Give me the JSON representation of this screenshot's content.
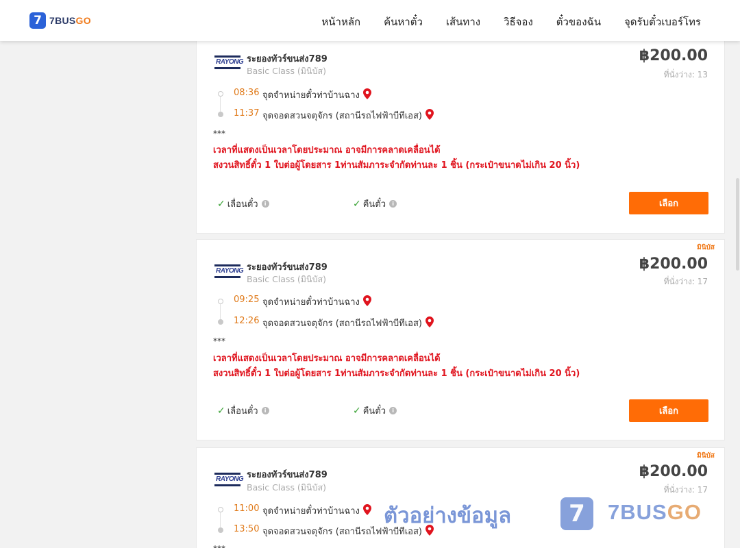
{
  "header": {
    "logo_mark": "7",
    "logo_text_main": "7BUS",
    "logo_text_accent": "GO",
    "nav": [
      {
        "label": "หน้าหลัก"
      },
      {
        "label": "ค้นหาตั๋ว"
      },
      {
        "label": "เส้นทาง"
      },
      {
        "label": "วิธีจอง"
      },
      {
        "label": "ตั๋วของฉัน"
      },
      {
        "label": "จุดรับตั๋วเบอร์โทร"
      }
    ]
  },
  "cards": [
    {
      "tag": "",
      "logo_text": "RAYONG",
      "operator": "ระยองทัวร์ขนส่ง789",
      "class": "Basic Class (มินิบัส)",
      "price": "฿200.00",
      "seats": "ที่นั่งว่าง: 13",
      "depart_time": "08:36",
      "depart_stop": "จุดจำหน่ายตั๋วท่าบ้านฉาง",
      "arrive_time": "11:37",
      "arrive_stop": "จุดจอดสวนจตุจักร (สถานีรถไฟฟ้าบีทีเอส)",
      "stars": "***",
      "note1": "เวลาที่แสดงเป็นเวลาโดยประมาณ อาจมีการคลาดเคลื่อนได้",
      "note2": "สงวนสิทธิ์ตั๋ว 1 ใบต่อผู้โดยสาร 1ท่านสัมภาระจำกัดท่านละ 1 ชิ้น (กระเป๋าขนาดไม่เกิน 20 นิ้ว)",
      "feature1": "เลื่อนตั๋ว",
      "feature2": "คืนตั๋ว",
      "button": "เลือก"
    },
    {
      "tag": "มินิบัส",
      "logo_text": "RAYONG",
      "operator": "ระยองทัวร์ขนส่ง789",
      "class": "Basic Class (มินิบัส)",
      "price": "฿200.00",
      "seats": "ที่นั่งว่าง: 17",
      "depart_time": "09:25",
      "depart_stop": "จุดจำหน่ายตั๋วท่าบ้านฉาง",
      "arrive_time": "12:26",
      "arrive_stop": "จุดจอดสวนจตุจักร (สถานีรถไฟฟ้าบีทีเอส)",
      "stars": "***",
      "note1": "เวลาที่แสดงเป็นเวลาโดยประมาณ อาจมีการคลาดเคลื่อนได้",
      "note2": "สงวนสิทธิ์ตั๋ว 1 ใบต่อผู้โดยสาร 1ท่านสัมภาระจำกัดท่านละ 1 ชิ้น (กระเป๋าขนาดไม่เกิน 20 นิ้ว)",
      "feature1": "เลื่อนตั๋ว",
      "feature2": "คืนตั๋ว",
      "button": "เลือก"
    },
    {
      "tag": "มินิบัส",
      "logo_text": "RAYONG",
      "operator": "ระยองทัวร์ขนส่ง789",
      "class": "Basic Class (มินิบัส)",
      "price": "฿200.00",
      "seats": "ที่นั่งว่าง: 17",
      "depart_time": "11:00",
      "depart_stop": "จุดจำหน่ายตั๋วท่าบ้านฉาง",
      "arrive_time": "13:50",
      "arrive_stop": "จุดจอดสวนจตุจักร (สถานีรถไฟฟ้าบีทีเอส)",
      "stars": "***"
    }
  ],
  "watermark": {
    "text": "ตัวอย่างข้อมูล",
    "badge": "7",
    "brand_main": "7BUS",
    "brand_accent": "GO"
  },
  "colors": {
    "accent": "#ff6c06",
    "brand_blue": "#2b62d8",
    "note_red": "#e0141e",
    "time_orange": "#e07a1a",
    "check_green": "#3aa335"
  },
  "icons": {
    "pin": "map-pin-icon",
    "check": "check-icon",
    "info": "info-icon"
  }
}
